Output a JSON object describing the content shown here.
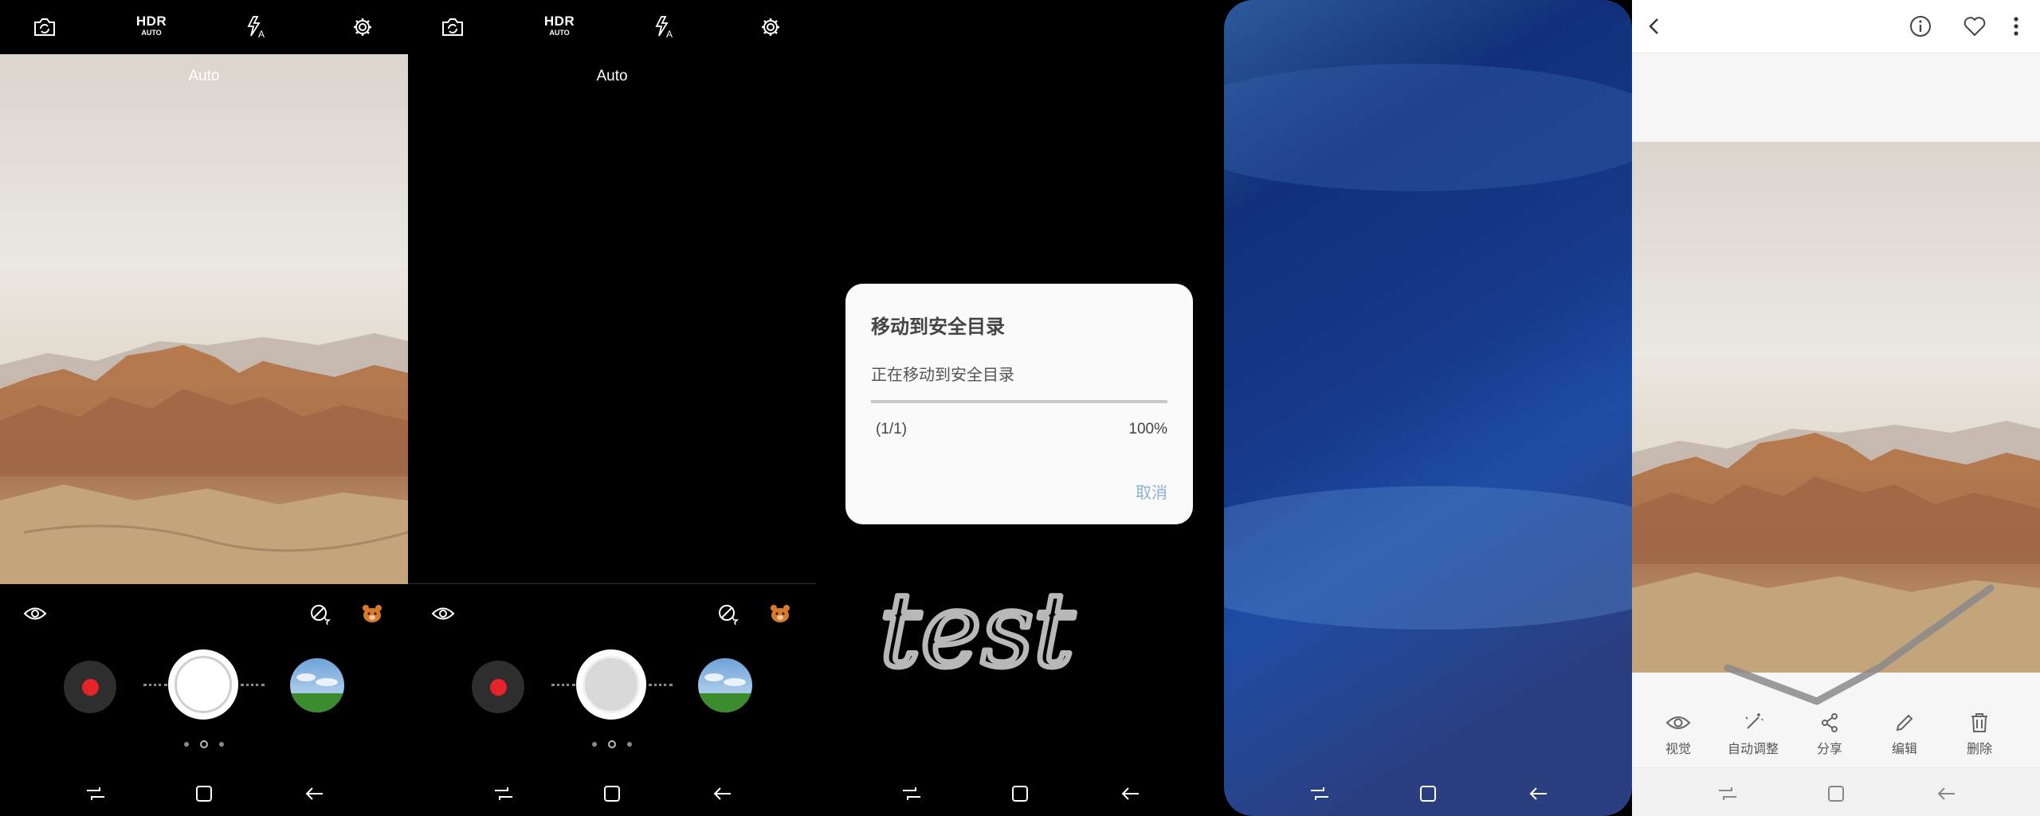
{
  "camera": {
    "hdr_main": "HDR",
    "hdr_sub": "AUTO",
    "mode_label": "Auto"
  },
  "dialog": {
    "title": "移动到安全目录",
    "message": "正在移动到安全目录",
    "progress": 1.0,
    "count": "(1/1)",
    "percent": "100%",
    "cancel": "取消"
  },
  "handwriting": "test",
  "gallery": {
    "actions": {
      "view": "视觉",
      "auto_adjust": "自动调整",
      "share": "分享",
      "edit": "编辑",
      "delete": "删除"
    }
  },
  "colors": {
    "record_red": "#e5232a",
    "dialog_bg": "#fafafa",
    "cancel_blue": "#8ab1d8"
  }
}
